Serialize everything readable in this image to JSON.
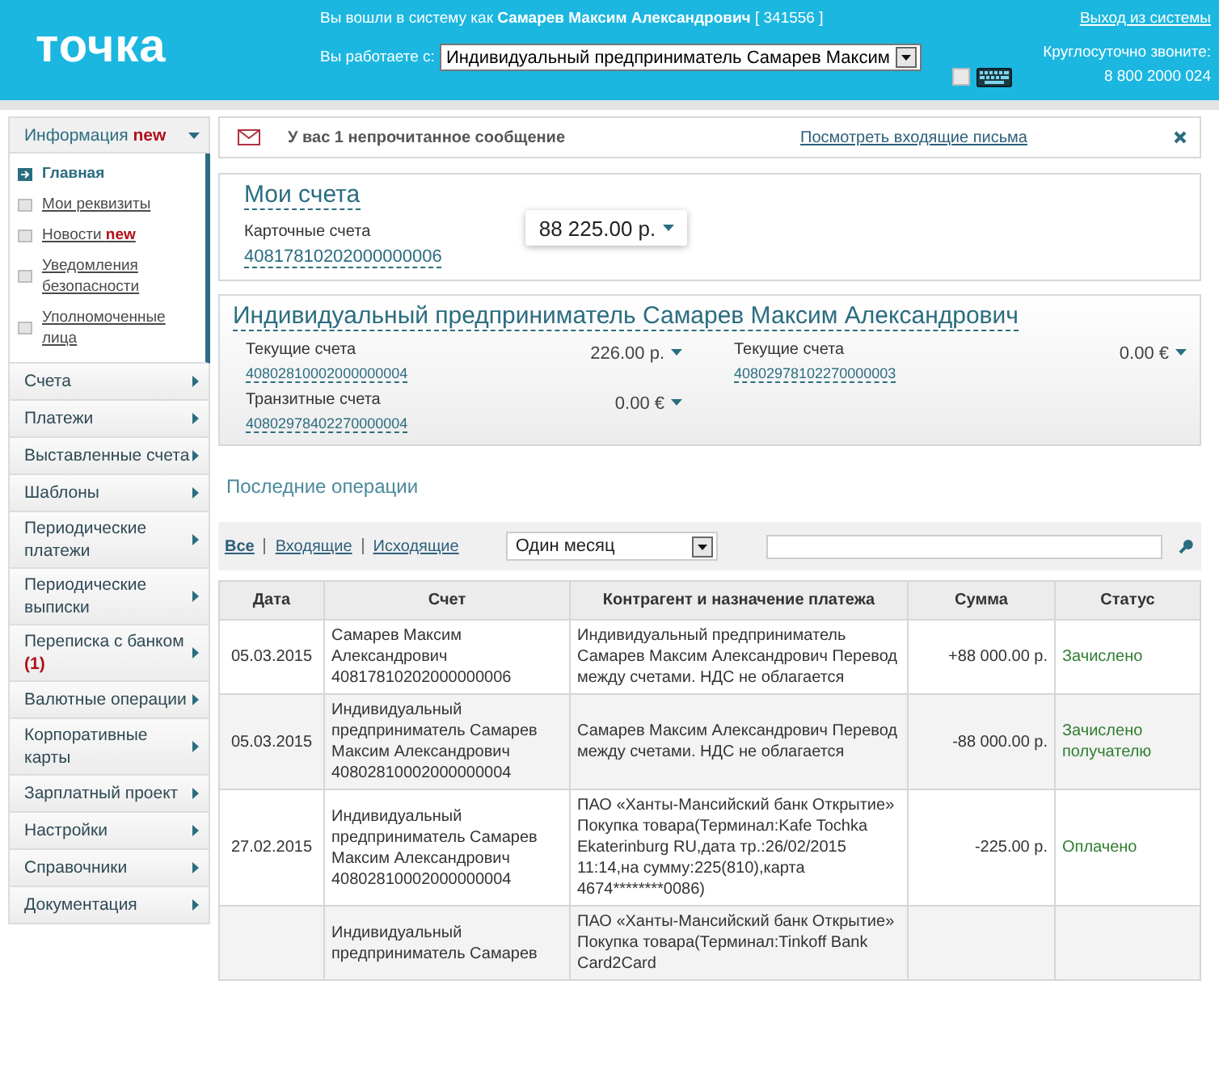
{
  "header": {
    "logo": "точка",
    "login_text": "Вы вошли в систему как **Самарев Максим Александрович** [ 341556 ]",
    "work_label": "Вы работаете с:",
    "work_select": "Индивидуальный предприниматель Самарев Максим",
    "keyboard_checkbox": {
      "checked": false
    },
    "logout": "Выход из системы",
    "phone_label": "Круглосуточно звоните:",
    "phone": "8 800 2000 024"
  },
  "sidebar": {
    "sections": [
      {
        "label": "Информация **new**",
        "expanded": true,
        "children": [
          {
            "label": "Главная",
            "selected": true
          },
          {
            "label": "Мои реквизиты",
            "selected": false
          },
          {
            "label": "Новости **new**",
            "selected": false
          },
          {
            "label": "Уведомления безопасности",
            "selected": false
          },
          {
            "label": "Уполномоченные лица",
            "selected": false
          }
        ]
      },
      {
        "label": "Счета",
        "expanded": false
      },
      {
        "label": "Платежи",
        "expanded": false
      },
      {
        "label": "Выставленные счета",
        "expanded": false
      },
      {
        "label": "Шаблоны",
        "expanded": false
      },
      {
        "label": "Периодические платежи",
        "expanded": false
      },
      {
        "label": "Периодические выписки",
        "expanded": false
      },
      {
        "label": "Переписка с банком **(1)**",
        "expanded": false
      },
      {
        "label": "Валютные операции",
        "expanded": false
      },
      {
        "label": "Корпоративные карты",
        "expanded": false
      },
      {
        "label": "Зарплатный проект",
        "expanded": false
      },
      {
        "label": "Настройки",
        "expanded": false
      },
      {
        "label": "Справочники",
        "expanded": false
      },
      {
        "label": "Документация",
        "expanded": false
      }
    ]
  },
  "notice": {
    "text": "У вас 1 непрочитанное сообщение",
    "link": "Посмотреть входящие письма"
  },
  "my_accounts": {
    "title": "Мои счета",
    "label": "Карточные счета",
    "number": "40817810202000000006",
    "balance": "88 225.00 р."
  },
  "company": {
    "title": "Индивидуальный предприниматель Самарев Максим Александрович",
    "accounts": [
      {
        "label": "Текущие счета",
        "number": "40802810002000000004",
        "balance": "226.00 р."
      },
      {
        "label": "Текущие счета",
        "number": "40802978102270000003",
        "balance": "0.00 €"
      },
      {
        "label": "Транзитные счета",
        "number": "40802978402270000004",
        "balance": "0.00 €"
      }
    ]
  },
  "operations": {
    "title": "Последние операции",
    "filters": [
      {
        "label": "Все",
        "selected": true
      },
      {
        "label": "Входящие",
        "selected": false
      },
      {
        "label": "Исходящие",
        "selected": false
      }
    ],
    "period": "Один месяц",
    "table": {
      "columns": [
        "Дата",
        "Счет",
        "Контрагент и назначение платежа",
        "Сумма",
        "Статус"
      ],
      "rows": [
        {
          "date": "05.03.2015",
          "account": "Самарев Максим Александрович 40817810202000000006",
          "party": "Индивидуальный предприниматель Самарев Максим Александрович Перевод между счетами. НДС не облагается",
          "amount": "+88 000.00 р.",
          "status": "Зачислено"
        },
        {
          "date": "05.03.2015",
          "account": "Индивидуальный предприниматель Самарев Максим Александрович 40802810002000000004",
          "party": "Самарев Максим Александрович Перевод между счетами. НДС не облагается",
          "amount": "-88 000.00 р.",
          "status": "Зачислено получателю"
        },
        {
          "date": "27.02.2015",
          "account": "Индивидуальный предприниматель Самарев Максим Александрович 40802810002000000004",
          "party": "ПАО «Ханты-Мансийский банк Открытие» Покупка товара(Терминал:Kafe Tochka Ekaterinburg RU,дата тр.:26/02/2015 11:14,на сумму:225(810),карта 4674********0086)",
          "amount": "-225.00 р.",
          "status": "Оплачено"
        },
        {
          "date": "",
          "account": "Индивидуальный предприниматель Самарев",
          "party": "ПАО «Ханты-Мансийский банк Открытие» Покупка товара(Терминал:Tinkoff Bank Card2Card",
          "amount": "",
          "status": ""
        }
      ]
    }
  }
}
